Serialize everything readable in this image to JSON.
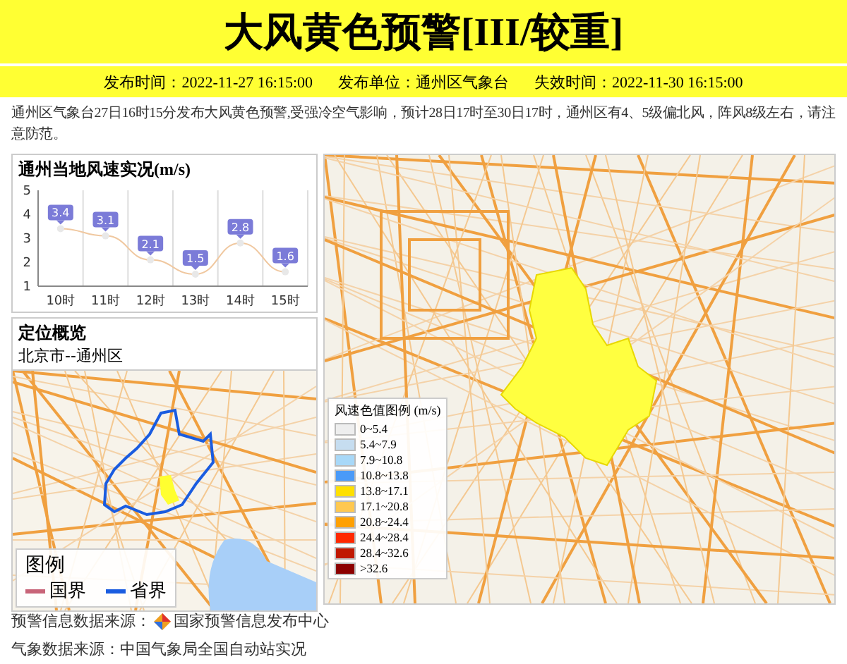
{
  "title": "大风黄色预警[III/较重]",
  "meta": [
    {
      "label": "发布时间：",
      "value": "2022-11-27 16:15:00"
    },
    {
      "label": "发布单位：",
      "value": "通州区气象台"
    },
    {
      "label": "失效时间：",
      "value": "2022-11-30 16:15:00"
    }
  ],
  "description": "通州区气象台27日16时15分发布大风黄色预警,受强冷空气影响，预计28日17时至30日17时，通州区有4、5级偏北风，阵风8级左右，请注意防范。",
  "wind_panel": {
    "title": "通州当地风速实况",
    "unit": "(m/s)",
    "chart_data": {
      "type": "line",
      "categories": [
        "10时",
        "11时",
        "12时",
        "13时",
        "14时",
        "15时"
      ],
      "series": [
        {
          "color": "#f0c8a0",
          "marker": "circle",
          "values": [
            3.4,
            3.1,
            2.1,
            1.5,
            2.8,
            1.6
          ]
        }
      ],
      "ylim": [
        1,
        5
      ],
      "yticks": [
        1,
        2,
        3,
        4,
        5
      ],
      "data_labels": true
    }
  },
  "location_panel": {
    "title": "定位概览",
    "subtitle": "北京市--通州区",
    "legend_title": "图例",
    "legend": [
      {
        "label": "国界",
        "color": "#c86478"
      },
      {
        "label": "省界",
        "color": "#1a5ce0"
      }
    ]
  },
  "wind_legend": {
    "title": "风速色值图例",
    "unit": "(m/s)",
    "items": [
      {
        "label": "0~5.4",
        "color": "#eeeeee"
      },
      {
        "label": "5.4~7.9",
        "color": "#c6ddf0"
      },
      {
        "label": "7.9~10.8",
        "color": "#a8d8f8"
      },
      {
        "label": "10.8~13.8",
        "color": "#4a9af8"
      },
      {
        "label": "13.8~17.1",
        "color": "#ffe000"
      },
      {
        "label": "17.1~20.8",
        "color": "#ffc850"
      },
      {
        "label": "20.8~24.4",
        "color": "#ffa000"
      },
      {
        "label": "24.4~28.4",
        "color": "#ff2800"
      },
      {
        "label": "28.4~32.6",
        "color": "#c01800"
      },
      {
        "label": ">32.6",
        "color": "#8c0000"
      }
    ]
  },
  "sources": [
    {
      "label": "预警信息数据来源：",
      "value": "国家预警信息发布中心",
      "kind": "logo"
    },
    {
      "label": "气象数据来源：",
      "value": "中国气象局全国自动站实况",
      "kind": "plain"
    }
  ]
}
